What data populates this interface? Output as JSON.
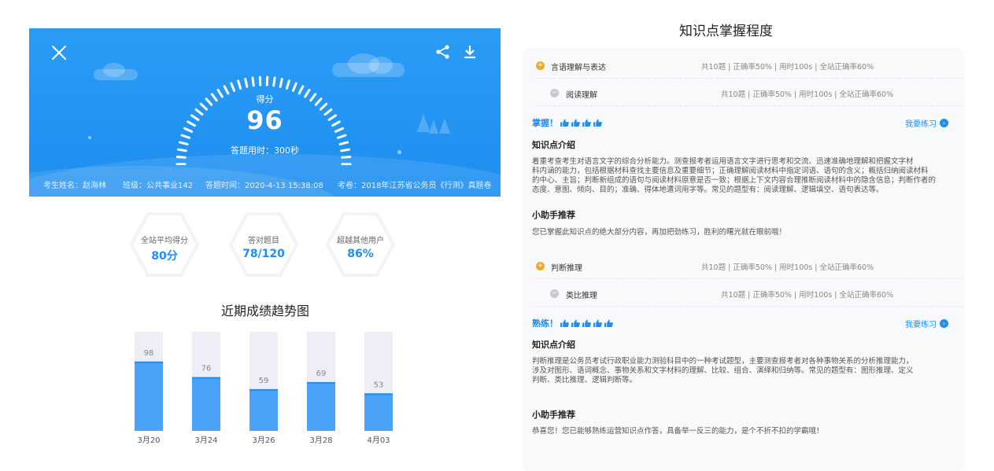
{
  "score_card": {
    "score_caption": "得分",
    "score": "96",
    "time_used": "答题用时：300秒",
    "info": {
      "name": "考生姓名：赵海林",
      "class": "班级：公共事业142",
      "time": "答题时间：2020-4-13 15:38:08",
      "paper": "考卷：2018年江苏省公务员《行测》真题卷"
    },
    "gauge_fraction": 0.96
  },
  "stats": [
    {
      "label": "全站平均得分",
      "value": "80分"
    },
    {
      "label": "答对题目",
      "value": "78/120"
    },
    {
      "label": "超越其他用户",
      "value": "86%"
    }
  ],
  "trend": {
    "title": "近期成绩趋势图"
  },
  "chart_data": {
    "type": "bar",
    "categories": [
      "3月20",
      "3月24",
      "3月26",
      "3月28",
      "4月03"
    ],
    "values": [
      98,
      76,
      59,
      69,
      53
    ],
    "data_labels": [
      "98",
      "76",
      "59",
      "69",
      "53"
    ],
    "title": "近期成绩趋势图",
    "xlabel": "",
    "ylabel": "",
    "ylim": [
      0,
      140
    ],
    "grid": false,
    "colors": {
      "bar": "#4aa3f8",
      "bar_top": "#1f8ef1",
      "track": "#eeeff6"
    }
  },
  "knowledge": {
    "title": "知识点掌握程度",
    "sections": [
      {
        "main": {
          "name": "言语理解与表达",
          "stats": "共10题  |  正确率50%  |  用时100s  |  全站正确率60%"
        },
        "sub": {
          "name": "阅读理解",
          "stats": "共10题  |  正确率50%  |  用时100s  |  全站正确率60%"
        },
        "mastery": "掌握！",
        "practice": "我要练习",
        "intro_heading": "知识点介绍",
        "intro_lines": [
          "着重考查考生对语言文字的综合分析能力。测查报考者运用语言文字进行思考和交流、迅速准确地理解和把握文字材",
          "料内涵的能力，包括根据材料查找主要信息及重要细节；正确理解阅读材料中指定词语、语句的含义；概括归纳阅读材料",
          "的中心、主旨；判断新组成的语句与阅读材料原意是否一致；根据上下文内容合理推断阅读材料中的隐含信息；判断作者的",
          "态度、意图、倾向、目的；准确、得体地遣词用字等。常见的题型有：阅读理解、逻辑填空、语句表达等。"
        ],
        "helper_heading": "小助手推荐",
        "helper_text": "您已掌握此知识点的绝大部分内容，再加把劲练习，胜利的曙光就在眼前哦！"
      },
      {
        "main": {
          "name": "判断推理",
          "stats": "共10题  |  正确率50%  |  用时100s  |  全站正确率60%"
        },
        "sub": {
          "name": "类比推理",
          "stats": "共10题  |  正确率50%  |  用时100s  |  全站正确率60%"
        },
        "mastery": "熟练！",
        "practice": "我要练习",
        "intro_heading": "知识点介绍",
        "intro_lines": [
          "判断推理是公务员考试行政职业能力测验科目中的一种考试题型，主要测查报考者对各种事物关系的分析推理能力，",
          "涉及对图形、语词概念、事物关系和文字材料的理解、比较、组合、演绎和归纳等。常见的题型有：图形推理、定义",
          "判断、类比推理、逻辑判断等。"
        ],
        "helper_heading": "小助手推荐",
        "helper_text": "恭喜您！您已能够熟练运营知识点作答，具备举一反三的能力，是个不折不扣的学霸哦！"
      }
    ]
  },
  "icons": [
    "close-icon",
    "share-icon",
    "download-icon",
    "plus-circle-icon",
    "minus-circle-icon",
    "thumbs-up-icon",
    "chevron-right-icon"
  ],
  "colors": {
    "primary": "#1f8ef1",
    "orange": "#f6a623",
    "grey": "#c7c9cf"
  }
}
